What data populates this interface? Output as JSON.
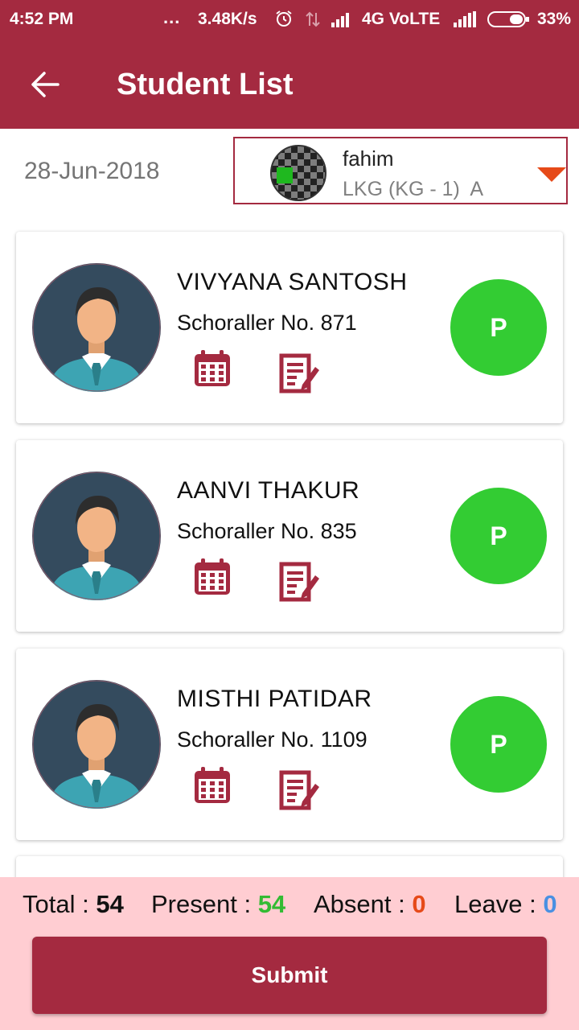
{
  "status_bar": {
    "time": "4:52 PM",
    "dots": "...",
    "speed": "3.48K/s",
    "network": "4G VoLTE",
    "battery": "33%"
  },
  "app_bar": {
    "title": "Student List"
  },
  "filters": {
    "date": "28-Jun-2018",
    "teacher_name": "fahim",
    "class_name": "LKG (KG - 1)  A"
  },
  "students": [
    {
      "name": "VIVYANA SANTOSH",
      "roll": "Schoraller No. 871",
      "status": "P"
    },
    {
      "name": "AANVI THAKUR",
      "roll": "Schoraller No. 835",
      "status": "P"
    },
    {
      "name": "MISTHI PATIDAR",
      "roll": "Schoraller No. 1109",
      "status": "P"
    }
  ],
  "summary": {
    "total_label": "Total : ",
    "total": "54",
    "present_label": "Present : ",
    "present": "54",
    "absent_label": "Absent : ",
    "absent": "0",
    "leave_label": "Leave : ",
    "leave": "0",
    "submit_label": "Submit"
  },
  "colors": {
    "primary": "#a42a40",
    "present_badge": "#33cc33",
    "summary_bg": "#ffcdd2",
    "present_value": "#33bb33",
    "absent_value": "#e64a19",
    "leave_value": "#4a90e2"
  }
}
